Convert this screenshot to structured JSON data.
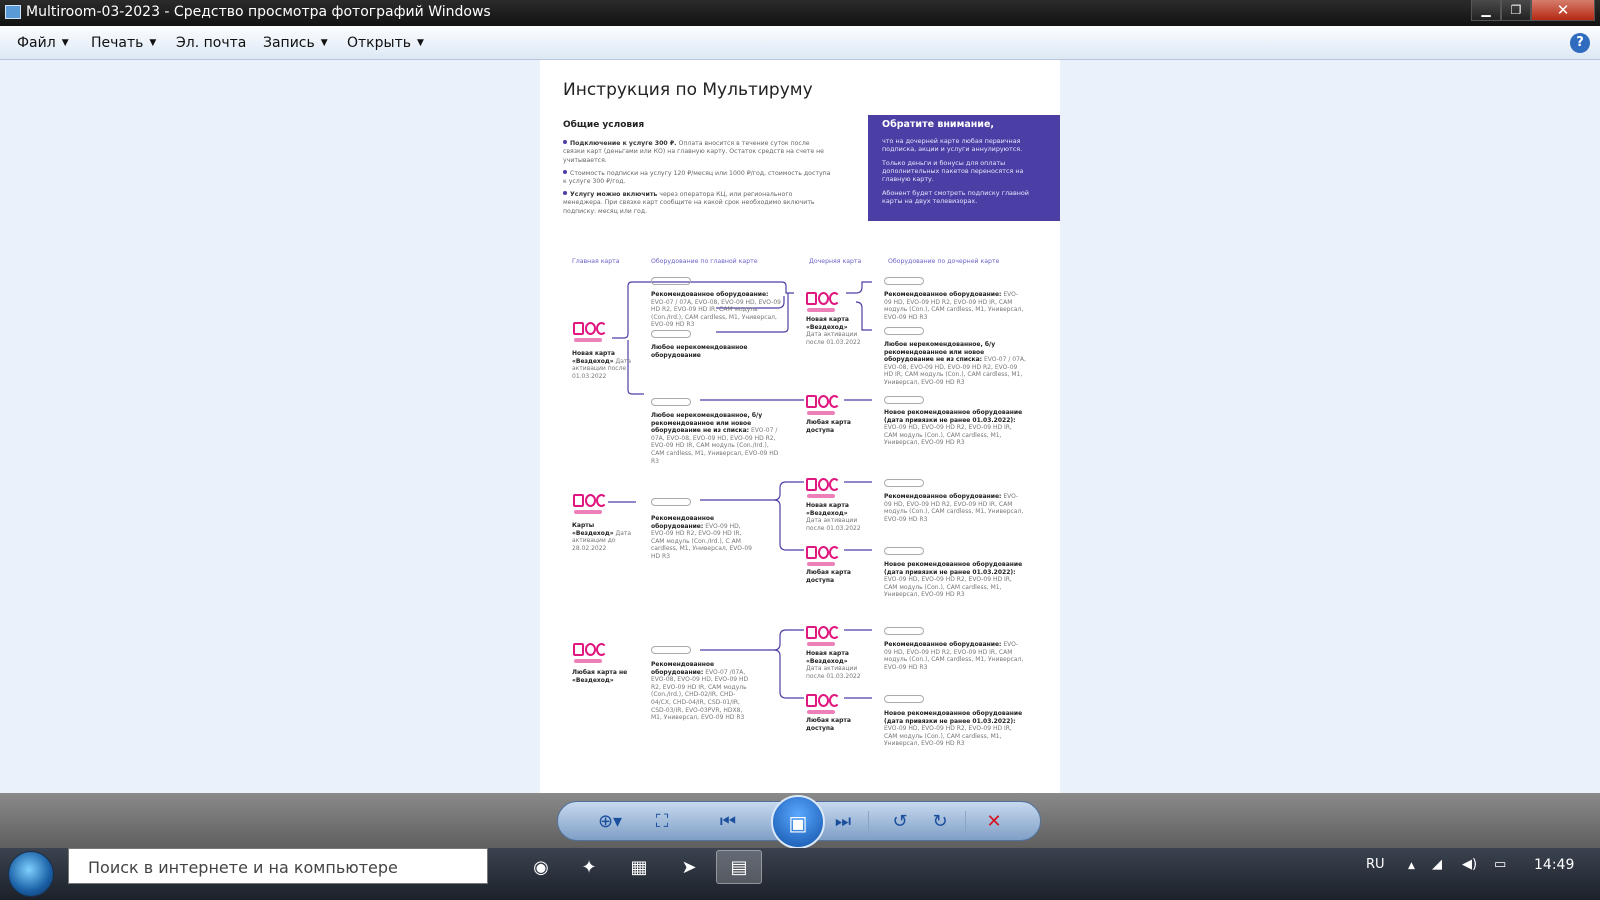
{
  "window": {
    "title": "Multiroom-03-2023 - Средство просмотра фотографий Windows",
    "min_icon": "minimize-icon",
    "max_icon": "maximize-icon",
    "close_icon": "close-icon",
    "min_glyph": "▁",
    "max_glyph": "❐",
    "close_glyph": "✕"
  },
  "menubar": {
    "items": [
      {
        "label": "Файл",
        "has_dropdown": true
      },
      {
        "label": "Печать",
        "has_dropdown": true
      },
      {
        "label": "Эл. почта",
        "has_dropdown": false
      },
      {
        "label": "Запись",
        "has_dropdown": true
      },
      {
        "label": "Открыть",
        "has_dropdown": true
      }
    ],
    "arrow_glyph": "▼",
    "help_glyph": "?"
  },
  "document": {
    "title": "Инструкция по Мультируму",
    "section_title": "Общие условия",
    "bullets": [
      {
        "bold": "Подключение к услуге 300 ₽.",
        "text": " Оплата вносится в течение суток после связки карт (деньгами или КО) на главную карту. Остаток средств на счете не учитывается."
      },
      {
        "bold": "",
        "text": "Стоимость подписки на услугу 120 ₽/месяц или 1000 ₽/год, стоимость доступа к услуге 300 ₽/год."
      },
      {
        "bold": "Услугу можно включить",
        "text": " через оператора КЦ, или регионального менеджера. При связке карт сообщите на какой срок необходимо включить подписку: месяц или год."
      }
    ],
    "notice": {
      "title": "Обратите внимание,",
      "paragraphs": [
        "что на дочерней карте любая первичная подписка, акции и услуги аннулируются.",
        "Только деньги и бонусы для оплаты дополнительных пакетов переносятся на главную карту.",
        "Абонент будет смотреть подписку главной карты на двух телевизорах."
      ]
    },
    "column_headers": [
      "Главная карта",
      "Оборудование по главной карте",
      "Дочерняя карта",
      "Оборудование по дочерней карте"
    ],
    "labels": [
      {
        "bold": "Рекомендованное оборудование:",
        "text": " EVO-07 / 07A, EVO-08, EVO-09 HD, EVO-09 HD R2, EVO-09 HD IR, CAM модуль (Con./Ird.), CAM cardless, M1, Универсал, EVO-09 HD R3"
      },
      {
        "bold": "Любое нерекомендованное оборудование",
        "text": ""
      },
      {
        "bold": "Новая карта «Вездеход»",
        "text": " Дата активации после 01.03.2022"
      },
      {
        "bold": "Любое нерекомендованное, б/у рекомендованное или новое оборудование не из списка:",
        "text": " EVO-07 / 07A, EVO-08, EVO-09 HD, EVO-09 HD R2, EVO-09 HD IR, CAM модуль (Con./Ird.), CAM cardless, M1, Универсал, EVO-09 HD R3"
      },
      {
        "bold": "Новая карта «Вездеход»",
        "text": " Дата активации после 01.03.2022"
      },
      {
        "bold": "Рекомендованное оборудование:",
        "text": " EVO-09 HD, EVO-09 HD R2, EVO-09 HD IR, CAM модуль (Con.), CAM cardless, M1, Универсал, EVO-09 HD R3"
      },
      {
        "bold": "Любое нерекомендованное, б/у рекомендованное или новое оборудование не из списка:",
        "text": " EVO-07 / 07A, EVO-08, EVO-09 HD, EVO-09 HD R2, EVO-09 HD IR, CAM модуль (Con.), CAM cardless, M1, Универсал, EVO-09 HD R3"
      },
      {
        "bold": "Любая карта доступа",
        "text": ""
      },
      {
        "bold": "Новое рекомендованное оборудование (дата привязки не ранее 01.03.2022):",
        "text": " EVO-09 HD, EVO-09 HD R2, EVO-09 HD IR, CAM модуль (Con.), CAM cardless, M1, Универсал, EVO-09 HD R3"
      },
      {
        "bold": "Карты «Вездеход»",
        "text": " Дата активации до 28.02.2022"
      },
      {
        "bold": "Рекомендованное оборудование:",
        "text": " EVO-09 HD, EVO-09 HD R2, EVO-09 HD IR, CAM модуль (Con./Ird.), C AM cardless, M1, Универсал, EVO-09 HD R3"
      },
      {
        "bold": "Новая карта «Вездеход»",
        "text": " Дата активации после 01.03.2022"
      },
      {
        "bold": "Рекомендованное оборудование:",
        "text": " EVO-09 HD, EVO-09 HD R2, EVO-09 HD IR, CAM модуль (Con.), CAM cardless, M1, Универсал, EVO-09 HD R3"
      },
      {
        "bold": "Любая карта доступа",
        "text": ""
      },
      {
        "bold": "Новое рекомендованное оборудование (дата привязки не ранее 01.03.2022):",
        "text": " EVO-09 HD, EVO-09 HD R2, EVO-09 HD IR, CAM модуль (Con.), CAM cardless, M1, Универсал, EVO-09 HD R3"
      },
      {
        "bold": "Любая карта не «Вездеход»",
        "text": ""
      },
      {
        "bold": "Рекомендованное оборудование:",
        "text": " EVO-07 /07A, EVO-08, EVO-09 HD, EVO-09 HD R2, EVO-09 HD IR, CAM модуль (Con./Ird.), CHD-02/IR, CHD-04/CX, CHD-04/IR, CSD-01/IR, CSD-03/IR, EVO-03PVR, HDX8, M1, Универсал, EVO-09 HD R3"
      },
      {
        "bold": "Новая карта «Вездеход»",
        "text": " Дата активации после 01.03.2022"
      },
      {
        "bold": "Рекомендованное оборудование:",
        "text": " EVO-09 HD, EVO-09 HD R2, EVO-09 HD IR, CAM модуль (Con.), CAM cardless, M1, Универсал, EVO-09 HD R3"
      },
      {
        "bold": "Любая карта доступа",
        "text": ""
      },
      {
        "bold": "Новое рекомендованное оборудование (дата привязки не ранее 01.03.2022):",
        "text": " EVO-09 HD, EVO-09 HD R2, EVO-09 HD IR, CAM модуль (Con.), CAM cardless, M1, Универсал, EVO-09 HD R3"
      }
    ],
    "colors": {
      "accent": "#4b3fa5",
      "brand": "#e0177f"
    }
  },
  "controls": {
    "buttons": [
      {
        "name": "zoom-icon",
        "glyph": "⊕▾"
      },
      {
        "name": "fit-window-icon",
        "glyph": "⛶"
      },
      {
        "name": "previous-icon",
        "glyph": "⏮"
      },
      {
        "name": "slideshow-icon",
        "glyph": "▣"
      },
      {
        "name": "next-icon",
        "glyph": "⏭"
      },
      {
        "name": "rotate-left-icon",
        "glyph": "↺"
      },
      {
        "name": "rotate-right-icon",
        "glyph": "↻"
      },
      {
        "name": "delete-icon",
        "glyph": "✕"
      }
    ]
  },
  "taskbar": {
    "search_placeholder": "Поиск в интернете и на компьютере",
    "apps": [
      {
        "name": "chrome-icon",
        "glyph": "◉"
      },
      {
        "name": "app-icon",
        "glyph": "✦"
      },
      {
        "name": "calculator-icon",
        "glyph": "▦"
      },
      {
        "name": "telegram-icon",
        "glyph": "➤"
      },
      {
        "name": "photo-viewer-icon",
        "glyph": "▤"
      }
    ],
    "language": "RU",
    "tray_arrow": "▲",
    "time": "14:49"
  }
}
